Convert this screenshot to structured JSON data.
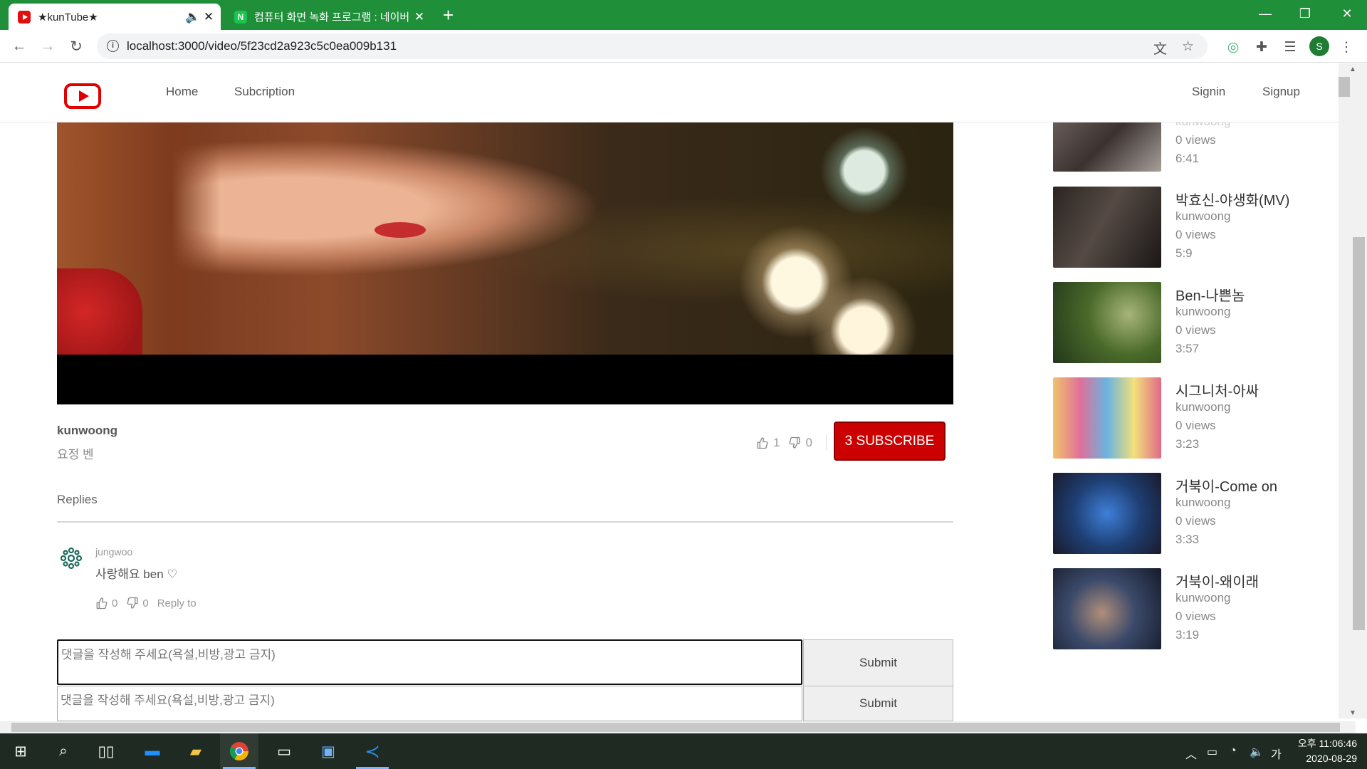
{
  "browser": {
    "tabs": [
      {
        "title": "★kunTube★",
        "active": true
      },
      {
        "title": "컴퓨터 화면 녹화 프로그램 : 네이버",
        "active": false
      }
    ],
    "url": "localhost:3000/video/5f23cd2a923c5c0ea009b131",
    "profile_initial": "S"
  },
  "header": {
    "menu": [
      "Home",
      "Subcription"
    ],
    "auth": [
      "Signin",
      "Signup"
    ]
  },
  "video": {
    "author": "kunwoong",
    "description": "요정 벤",
    "likes": "1",
    "dislikes": "0",
    "subscribe_label": "3 SUBSCRIBE"
  },
  "comments": {
    "section_label": "Replies",
    "items": [
      {
        "user": "jungwoo",
        "text": "사랑해요 ben ♡",
        "likes": "0",
        "dislikes": "0",
        "reply_label": "Reply to"
      }
    ],
    "placeholder": "댓글을 작성해 주세요(욕설,비방,광고 금지)",
    "submit_label": "Submit"
  },
  "sidebar": {
    "items": [
      {
        "title": "",
        "author": "kunwoong",
        "views": "0 views",
        "duration": "6:41"
      },
      {
        "title": "박효신-야생화(MV)",
        "author": "kunwoong",
        "views": "0 views",
        "duration": "5:9"
      },
      {
        "title": "Ben-나쁜놈",
        "author": "kunwoong",
        "views": "0 views",
        "duration": "3:57"
      },
      {
        "title": "시그니처-아싸",
        "author": "kunwoong",
        "views": "0 views",
        "duration": "3:23"
      },
      {
        "title": "거북이-Come on",
        "author": "kunwoong",
        "views": "0 views",
        "duration": "3:33"
      },
      {
        "title": "거북이-왜이래",
        "author": "kunwoong",
        "views": "0 views",
        "duration": "3:19"
      }
    ]
  },
  "taskbar": {
    "clock_time": "오후 11:06:46",
    "clock_date": "2020-08-29",
    "ime": "가"
  }
}
